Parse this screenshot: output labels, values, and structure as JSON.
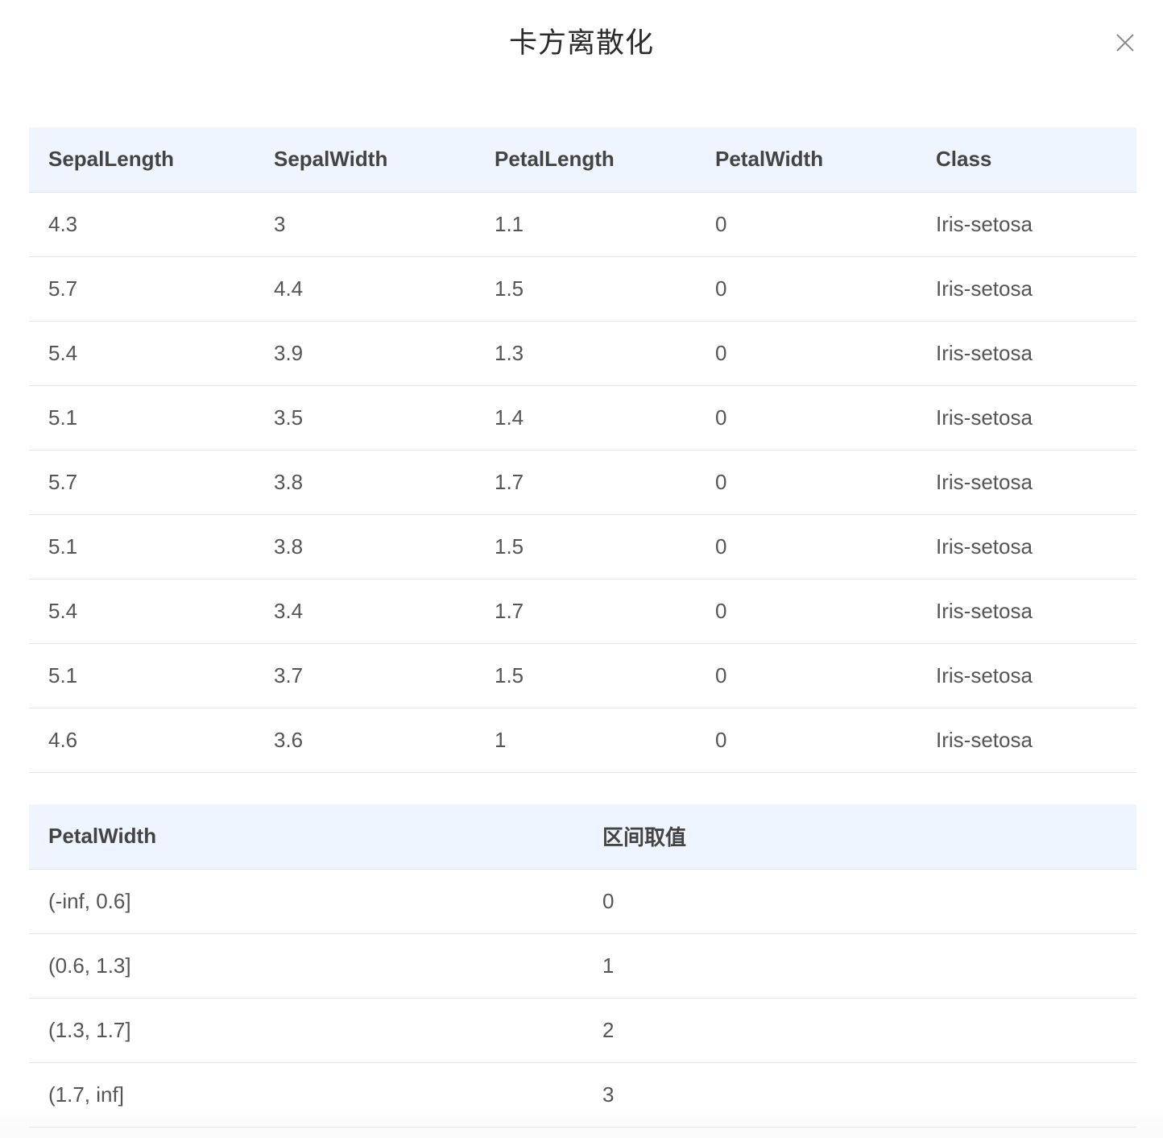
{
  "dialog": {
    "title": "卡方离散化",
    "close_icon": "close-icon"
  },
  "data_table": {
    "columns": [
      "SepalLength",
      "SepalWidth",
      "PetalLength",
      "PetalWidth",
      "Class"
    ],
    "rows": [
      [
        "4.3",
        "3",
        "1.1",
        "0",
        "Iris-setosa"
      ],
      [
        "5.7",
        "4.4",
        "1.5",
        "0",
        "Iris-setosa"
      ],
      [
        "5.4",
        "3.9",
        "1.3",
        "0",
        "Iris-setosa"
      ],
      [
        "5.1",
        "3.5",
        "1.4",
        "0",
        "Iris-setosa"
      ],
      [
        "5.7",
        "3.8",
        "1.7",
        "0",
        "Iris-setosa"
      ],
      [
        "5.1",
        "3.8",
        "1.5",
        "0",
        "Iris-setosa"
      ],
      [
        "5.4",
        "3.4",
        "1.7",
        "0",
        "Iris-setosa"
      ],
      [
        "5.1",
        "3.7",
        "1.5",
        "0",
        "Iris-setosa"
      ],
      [
        "4.6",
        "3.6",
        "1",
        "0",
        "Iris-setosa"
      ]
    ]
  },
  "bins_table": {
    "columns": [
      "PetalWidth",
      "区间取值"
    ],
    "rows": [
      [
        "(-inf, 0.6]",
        "0"
      ],
      [
        "(0.6, 1.3]",
        "1"
      ],
      [
        "(1.3, 1.7]",
        "2"
      ],
      [
        "(1.7, inf]",
        "3"
      ]
    ]
  },
  "colors": {
    "header_bg": "#eef5fe",
    "row_border": "#e6e6e6",
    "text": "#555555"
  }
}
